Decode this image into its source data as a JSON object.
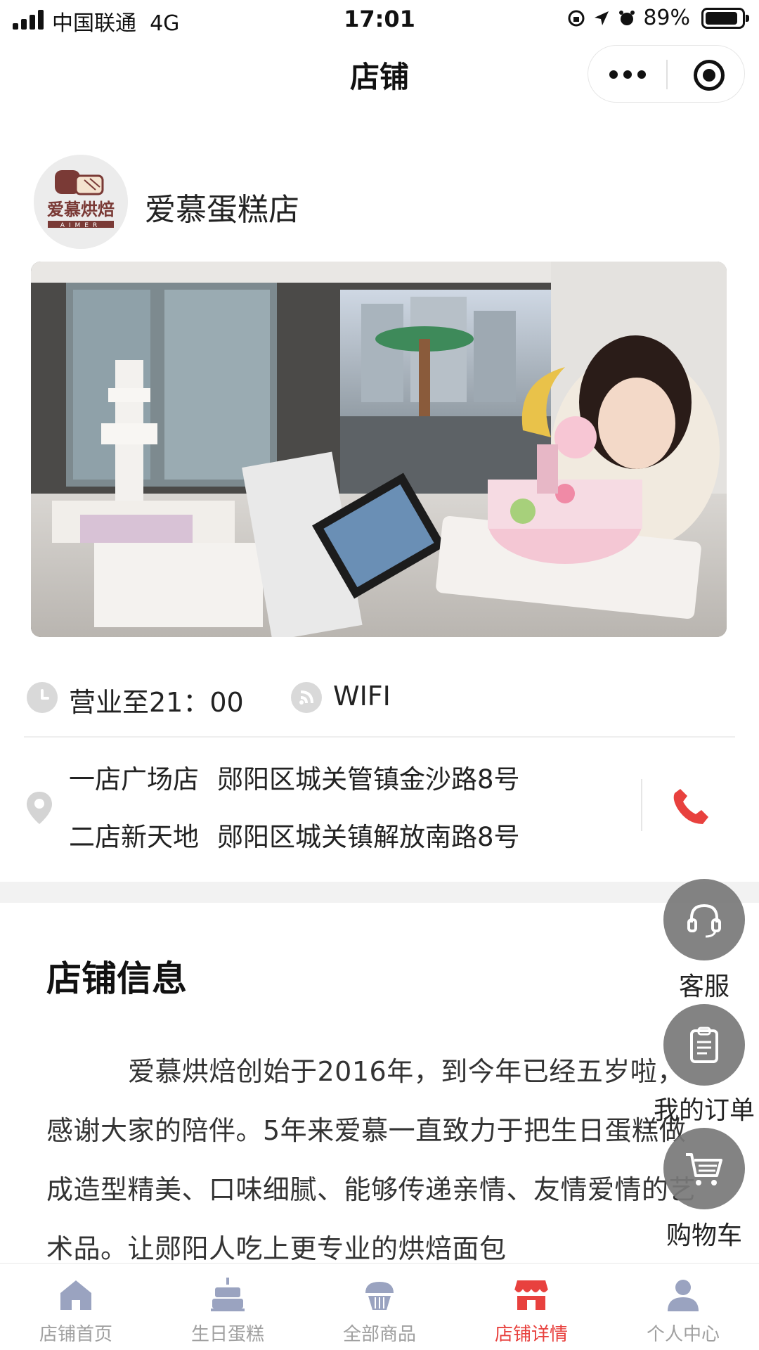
{
  "status_bar": {
    "carrier": "中国联通",
    "network": "4G",
    "time": "17:01",
    "battery": "89%",
    "battery_level": 0.89
  },
  "nav": {
    "title": "店铺",
    "more_icon": "more-dots-icon",
    "close_icon": "target-close-icon"
  },
  "store": {
    "name": "爱慕蛋糕店",
    "logo_text": "爱慕烘焙",
    "logo_subtext": "AIMER"
  },
  "info": {
    "hours": "营业至21：00",
    "wifi": "WIFI",
    "addresses": [
      {
        "name": "一店广场店",
        "address": "郧阳区城关管镇金沙路8号"
      },
      {
        "name": "二店新天地",
        "address": "郧阳区城关镇解放南路8号"
      }
    ]
  },
  "section": {
    "title": "店铺信息",
    "intro": "爱慕烘焙创始于2016年，到今年已经五岁啦，感谢大家的陪伴。5年来爱慕一直致力于把生日蛋糕做成造型精美、口味细腻、能够传递亲情、友情爱情的艺术品。让郧阳人吃上更专业的烘焙面包"
  },
  "floating": [
    {
      "label": "客服",
      "icon": "headset-icon"
    },
    {
      "label": "我的订单",
      "icon": "clipboard-icon"
    },
    {
      "label": "购物车",
      "icon": "cart-icon"
    }
  ],
  "tabs": [
    {
      "label": "店铺首页",
      "icon": "home-icon"
    },
    {
      "label": "生日蛋糕",
      "icon": "cake-icon"
    },
    {
      "label": "全部商品",
      "icon": "cupcake-icon"
    },
    {
      "label": "店铺详情",
      "icon": "store-icon",
      "active": true
    },
    {
      "label": "个人中心",
      "icon": "user-icon"
    }
  ],
  "colors": {
    "accent": "#e8413e",
    "tab_inactive": "#a0a0a0",
    "fab_bg": "#787878"
  }
}
